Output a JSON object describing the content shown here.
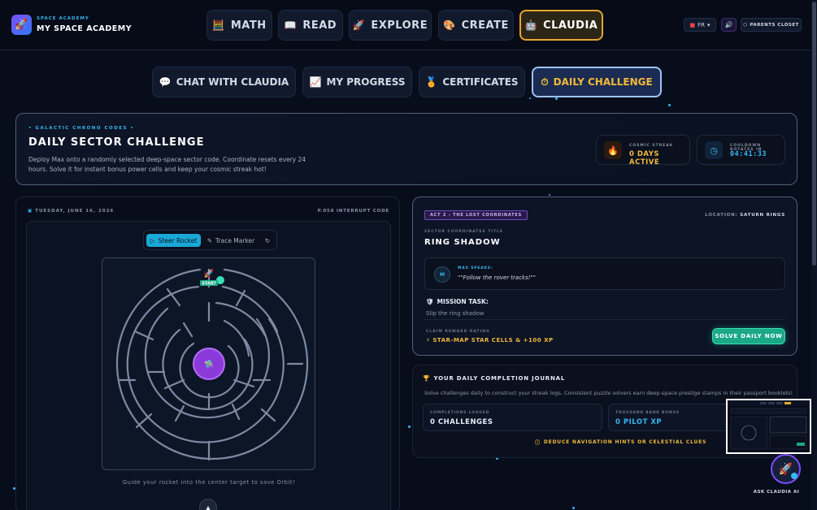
{
  "brand": {
    "kicker": "SPACE ACADEMY",
    "name": "MY SPACE ACADEMY"
  },
  "nav": [
    {
      "label": "MATH",
      "icon": "abacus-icon",
      "glyph": "🧮"
    },
    {
      "label": "READ",
      "icon": "book-icon",
      "glyph": "📖"
    },
    {
      "label": "EXPLORE",
      "icon": "rocket-icon",
      "glyph": "🚀"
    },
    {
      "label": "CREATE",
      "icon": "palette-icon",
      "glyph": "🎨"
    },
    {
      "label": "CLAUDIA",
      "icon": "robot-icon",
      "glyph": "🤖",
      "active": true
    }
  ],
  "topright": {
    "lang": "FR",
    "parents": "PARENTS CLOSET"
  },
  "subtabs": [
    {
      "label": "CHAT WITH CLAUDIA",
      "glyph": "💬"
    },
    {
      "label": "MY PROGRESS",
      "glyph": "📈"
    },
    {
      "label": "CERTIFICATES",
      "glyph": "🏅"
    },
    {
      "label": "DAILY CHALLENGE",
      "glyph": "⏱",
      "active": true
    }
  ],
  "hero": {
    "kicker": "• GALACTIC CHRONO CODES •",
    "title": "DAILY SECTOR CHALLENGE",
    "description": "Deploy Max onto a randomly selected deep-space sector code. Coordinate resets every 24 hours. Solve it for instant bonus power cells and keep your cosmic streak hot!",
    "streak_label": "COSMIC STREAK",
    "streak_value": "0 DAYS ACTIVE",
    "cooldown_label": "COOLDOWN ROTATES IN",
    "cooldown_value": "04:41:33"
  },
  "left": {
    "date": "TUESDAY, JUNE 16, 2026",
    "interrupt": "P.058 INTERRUPT CODE",
    "steer": "Steer Rocket",
    "trace": "Trace Marker",
    "start": "START",
    "guide": "Guide your rocket into the center target to save Orbit!"
  },
  "mission": {
    "act": "ACT 2 - THE LOST COORDINATES",
    "location_label": "LOCATION:",
    "location_value": "SATURN RINGS",
    "sector_label": "SECTOR COORDINATES TITLE",
    "sector_title": "RING SHADOW",
    "avatar": "M",
    "speaks_label": "MAX SPEAKS:",
    "speaks_text": "\"\"Follow the rover tracks!\"\"",
    "task_label": "MISSION TASK:",
    "task_text": "Slip the ring shadow",
    "reward_label": "CLAIM REWARD RATING",
    "reward_value": "⚡ STAR-MAP STAR CELLS & +100 XP",
    "solve": "SOLVE DAILY NOW"
  },
  "journal": {
    "title": "YOUR DAILY COMPLETION JOURNAL",
    "description": "Solve challenges daily to construct your streak logs. Consistent puzzle solvers earn deep-space prestige stamps in their passport booklets!",
    "logged_label": "COMPLETIONS LOGGED",
    "logged_value": "0 CHALLENGES",
    "bonus_label": "THOUSAND BANK BONUS",
    "bonus_value": "0 PILOT XP",
    "hint": "DEDUCE NAVIGATION HINTS OR CELESTIAL CLUES"
  },
  "ask": "ASK CLAUDIA AI",
  "colors": {
    "accent_cyan": "#38b6f0",
    "gold": "#f2b93b",
    "orange": "#e8a531",
    "green": "#1aa886",
    "purple": "#7c4dff"
  }
}
